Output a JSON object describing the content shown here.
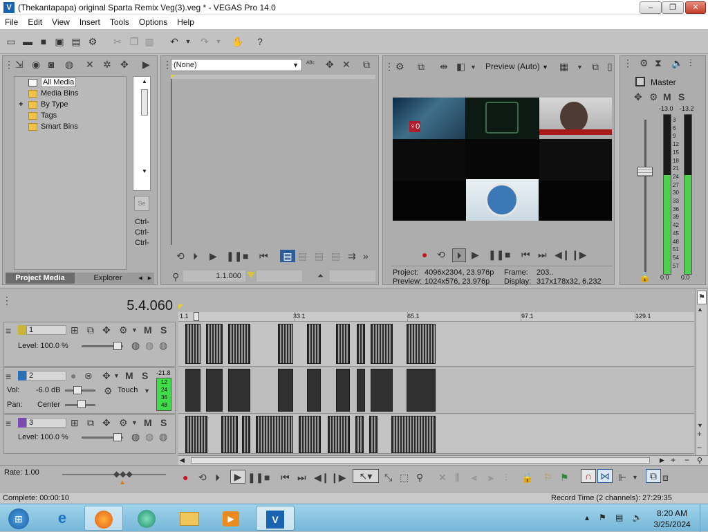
{
  "window": {
    "title": "(Thekantapapa) original Sparta Remix Veg(3).veg * - VEGAS Pro 14.0",
    "logo_glyph": "V",
    "controls": {
      "minimize": "–",
      "maximize": "❐",
      "close": "✕"
    }
  },
  "menu": [
    "File",
    "Edit",
    "View",
    "Insert",
    "Tools",
    "Options",
    "Help"
  ],
  "project_media": {
    "tree": [
      {
        "label": "All Media",
        "selected": true
      },
      {
        "label": "Media Bins"
      },
      {
        "label": "By Type",
        "expander": "+"
      },
      {
        "label": "Tags"
      },
      {
        "label": "Smart Bins"
      }
    ],
    "side_labels": [
      "Ctrl-",
      "Ctrl-",
      "Ctrl-"
    ],
    "side_button": "Se",
    "tabs": {
      "project_media": "Project Media",
      "explorer": "Explorer"
    }
  },
  "trimmer": {
    "dropdown_value": "(None)",
    "timecode": "1.1.000"
  },
  "preview": {
    "mode_label": "Preview (Auto)",
    "info": {
      "project_label": "Project:",
      "project_value": "4096x2304, 23.976p",
      "preview_label": "Preview:",
      "preview_value": "1024x576, 23.976p",
      "frame_label": "Frame:",
      "frame_value": "203..",
      "display_label": "Display:",
      "display_value": "317x178x32, 6.232"
    },
    "thumb_text": "♀0"
  },
  "master": {
    "label": "Master",
    "m": "M",
    "s": "S",
    "peak_left": "-13.0",
    "peak_right": "-13.2",
    "scale": [
      "3",
      "6",
      "9",
      "12",
      "15",
      "18",
      "21",
      "24",
      "27",
      "30",
      "33",
      "36",
      "39",
      "42",
      "45",
      "48",
      "51",
      "54",
      "57"
    ],
    "level_left": 0.62,
    "level_right": 0.62,
    "bottom_left": "0.0",
    "bottom_right": "0.0"
  },
  "timeline": {
    "position": "5.4.060",
    "ruler_marks": [
      "1.1",
      "33.1",
      "65.1",
      "97.1",
      "129.1"
    ],
    "tracks": [
      {
        "number": "1",
        "type": "video",
        "level_label": "Level: 100.0 %",
        "m": "M",
        "s": "S",
        "color": "#c8b53a"
      },
      {
        "number": "2",
        "type": "audio",
        "vol_label": "Vol:",
        "vol_value": "-6.0 dB",
        "pan_label": "Pan:",
        "pan_value": "Center",
        "mode": "Touch",
        "m": "M",
        "s": "S",
        "meter_top": "-21.8",
        "meter_scale": [
          "12",
          "24",
          "36",
          "48"
        ],
        "color": "#2a6fb8"
      },
      {
        "number": "3",
        "type": "video",
        "level_label": "Level: 100.0 %",
        "m": "M",
        "s": "S",
        "color": "#7a4bb0"
      }
    ],
    "rate_label": "Rate: 1.00"
  },
  "status": {
    "left": "Complete: 00:00:10",
    "right": "Record Time (2 channels): 27:29:35"
  },
  "taskbar": {
    "time": "8:20 AM",
    "date": "3/25/2024"
  },
  "colors": {
    "meter_green": "#4fcf4f",
    "clip_dark": "#303030",
    "taskbar": "#8cc7e3"
  }
}
